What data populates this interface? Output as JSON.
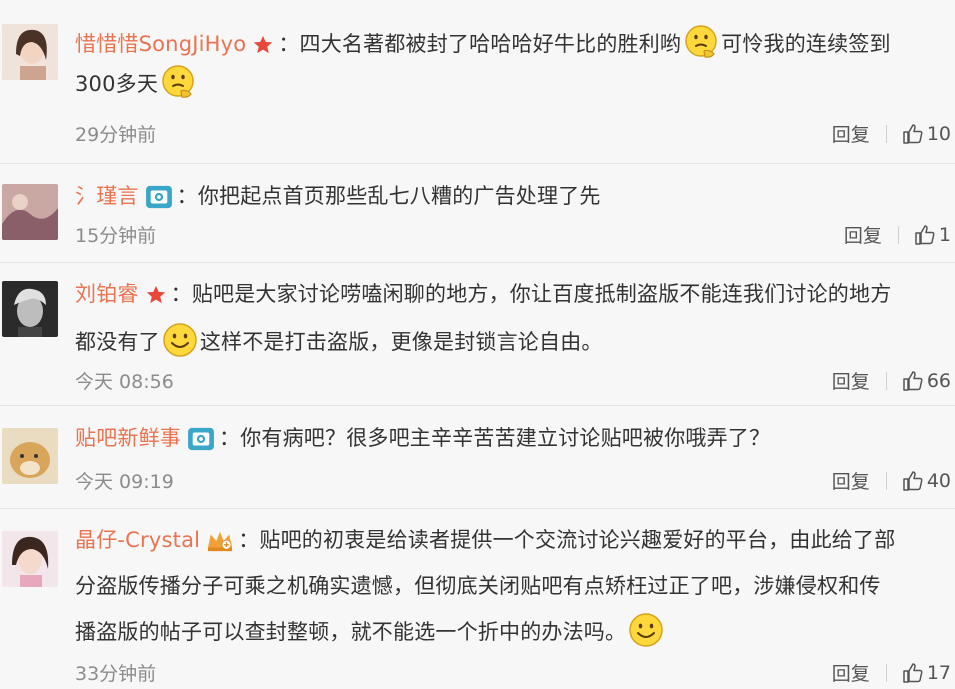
{
  "comments": [
    {
      "author": "惜惜惜SongJiHyo",
      "badge": "star-icon",
      "separator": "：",
      "text_segments": [
        "四大名著都被封了哈哈哈好牛比的胜利哟",
        "可怜我的连续签到",
        "300多天"
      ],
      "time": "29分钟前",
      "reply_label": "回复",
      "likes": "10"
    },
    {
      "author": "氵瑾言",
      "badge": "camera-icon",
      "separator": "：",
      "text_segments": [
        "你把起点首页那些乱七八糟的广告处理了先"
      ],
      "time": "15分钟前",
      "reply_label": "回复",
      "likes": "1"
    },
    {
      "author": "刘铂睿",
      "badge": "star-icon",
      "separator": "：",
      "text_segments": [
        "贴吧是大家讨论唠嗑闲聊的地方，你让百度抵制盗版不能连我们讨论的地方",
        "都没有了",
        "这样不是打击盗版，更像是封锁言论自由。"
      ],
      "time": "今天 08:56",
      "reply_label": "回复",
      "likes": "66"
    },
    {
      "author": "贴吧新鲜事",
      "badge": "camera-icon",
      "separator": "：",
      "text_segments": [
        "你有病吧？很多吧主辛辛苦苦建立讨论贴吧被你哦弄了？"
      ],
      "time": "今天 09:19",
      "reply_label": "回复",
      "likes": "40"
    },
    {
      "author": "晶仔-Crystal",
      "badge": "crown-icon",
      "separator": "：",
      "text_segments": [
        "贴吧的初衷是给读者提供一个交流讨论兴趣爱好的平台，由此给了部",
        "分盗版传播分子可乘之机确实遗憾，但彻底关闭贴吧有点矫枉过正了吧，涉嫌侵权和传",
        "播盗版的帖子可以查封整顿，就不能选一个折中的办法吗。"
      ],
      "time": "33分钟前",
      "reply_label": "回复",
      "likes": "17"
    }
  ],
  "colors": {
    "author": "#eb7350",
    "text": "#333333",
    "meta": "#8c8c8c",
    "background": "#f7f7f7"
  }
}
